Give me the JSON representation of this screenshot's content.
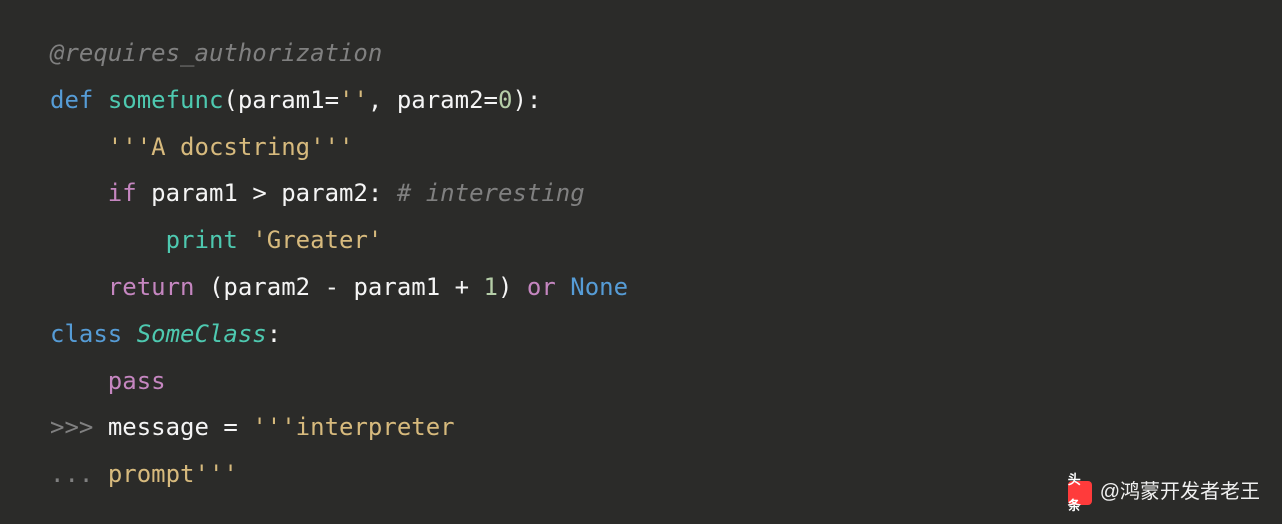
{
  "code": {
    "line1": {
      "decorator": "@requires_authorization"
    },
    "line2": {
      "def": "def",
      "funcname": "somefunc",
      "lparen": "(",
      "param1": "param1",
      "eq1": "=",
      "str1": "''",
      "comma": ",",
      "param2": "param2",
      "eq2": "=",
      "zero": "0",
      "rparen": ")",
      "colon": ":"
    },
    "line3": {
      "docstring": "'''A docstring'''"
    },
    "line4": {
      "if": "if",
      "param1": "param1",
      "gt": ">",
      "param2": "param2",
      "colon": ":",
      "comment": "# interesting"
    },
    "line5": {
      "print": "print",
      "greater": "'Greater'"
    },
    "line6": {
      "return": "return",
      "lparen": "(",
      "param2": "param2",
      "minus": "-",
      "param1": "param1",
      "plus": "+",
      "one": "1",
      "rparen": ")",
      "or": "or",
      "none": "None"
    },
    "line7": {
      "class": "class",
      "classname": "SomeClass",
      "colon": ":"
    },
    "line8": {
      "pass": "pass"
    },
    "line9": {
      "prompt": ">>>",
      "message": "message",
      "eq": "=",
      "str": "'''interpreter"
    },
    "line10": {
      "dots": "...",
      "prompt_str": "prompt'''"
    }
  },
  "watermark": {
    "logo_text": "头条",
    "text": "@鸿蒙开发者老王"
  }
}
